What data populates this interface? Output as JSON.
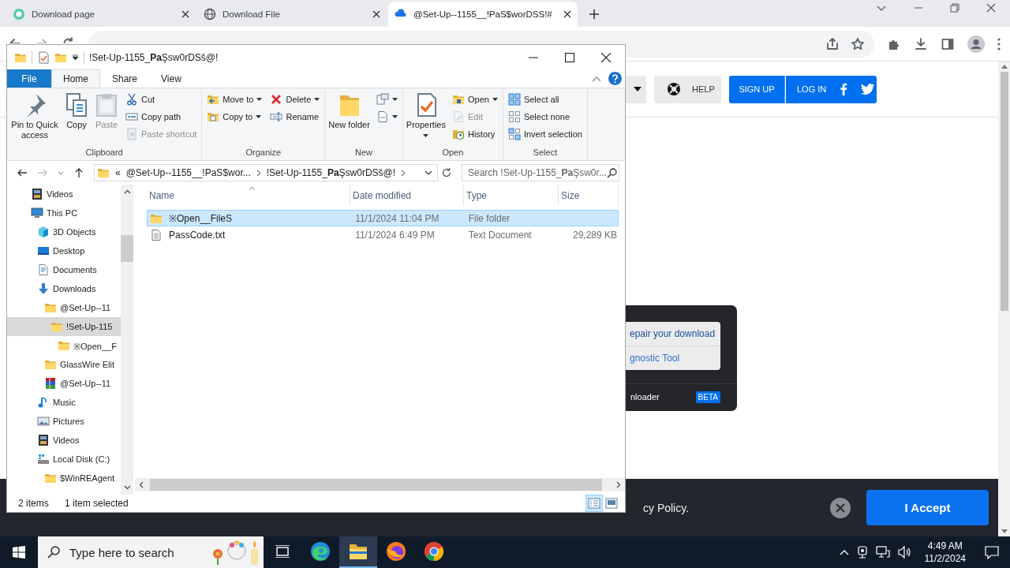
{
  "browser": {
    "tabs": [
      {
        "title": "Download page",
        "kind": "circle",
        "selected": false
      },
      {
        "title": "Download File",
        "kind": "globe",
        "selected": false
      },
      {
        "title": "@Set-Up--1155__!PaS$worDSS!#",
        "kind": "cloud",
        "selected": true
      }
    ]
  },
  "site": {
    "header_buttons": [
      {
        "kind": "menu"
      },
      {
        "kind": "help",
        "label": "HELP"
      },
      {
        "kind": "signup",
        "label": "SIGN UP"
      },
      {
        "kind": "login",
        "label": "LOG IN"
      }
    ],
    "popup": {
      "links": [
        "epair your download",
        "gnostic Tool"
      ],
      "footer": "nloader",
      "badge": "BETA"
    },
    "cookie_bar": {
      "text": "cy Policy.",
      "button": "I Accept"
    }
  },
  "explorer": {
    "title": "!Set-Up-1155_**Pa**Şsw0rDSš@!",
    "ribbon_tabs": [
      {
        "label": "File",
        "kind": "file",
        "selected": false
      },
      {
        "label": "Home",
        "kind": "tab",
        "selected": true
      },
      {
        "label": "Share",
        "kind": "tab",
        "selected": false
      },
      {
        "label": "View",
        "kind": "tab",
        "selected": false
      }
    ],
    "ribbon_groups": [
      {
        "label": "Clipboard",
        "large": [
          {
            "label": "Pin to Quick access",
            "kind": "pin",
            "disabled": false
          },
          {
            "label": "Copy",
            "kind": "copy",
            "disabled": false
          },
          {
            "label": "Paste",
            "kind": "paste",
            "disabled": true
          }
        ],
        "stacks": [
          [
            {
              "label": "Cut",
              "kind": "cut",
              "disabled": false
            },
            {
              "label": "Copy path",
              "kind": "copypath",
              "disabled": false
            },
            {
              "label": "Paste shortcut",
              "kind": "pasteshortcut",
              "disabled": true
            }
          ]
        ]
      },
      {
        "label": "Organize",
        "stacks": [
          [
            {
              "label": "Move to",
              "kind": "moveto",
              "menu": true,
              "disabled": false
            },
            {
              "label": "Copy to",
              "kind": "copyto",
              "menu": true,
              "disabled": false
            }
          ],
          [
            {
              "label": "Delete",
              "kind": "delete",
              "menu": true,
              "disabled": false
            },
            {
              "label": "Rename",
              "kind": "rename",
              "disabled": false
            }
          ]
        ]
      },
      {
        "label": "New",
        "large": [
          {
            "label": "New folder",
            "kind": "newfolder",
            "disabled": false
          }
        ],
        "stacks": [
          [
            {
              "kind": "newitem",
              "menu": true,
              "disabled": false
            },
            {
              "kind": "easyaccess",
              "menu": true,
              "disabled": false
            }
          ]
        ]
      },
      {
        "label": "Open",
        "large": [
          {
            "label": "Properties",
            "kind": "properties",
            "menu": true,
            "disabled": false
          }
        ],
        "stacks": [
          [
            {
              "label": "Open",
              "kind": "open",
              "menu": true,
              "disabled": false
            },
            {
              "label": "Edit",
              "kind": "edit",
              "disabled": true
            },
            {
              "label": "History",
              "kind": "history",
              "disabled": false
            }
          ]
        ]
      },
      {
        "label": "Select",
        "stacks": [
          [
            {
              "label": "Select all",
              "kind": "selectall",
              "disabled": false
            },
            {
              "label": "Select none",
              "kind": "selectnone",
              "disabled": false
            },
            {
              "label": "Invert selection",
              "kind": "invert",
              "disabled": false
            }
          ]
        ]
      }
    ],
    "address": {
      "overflow": "«",
      "crumbs": [
        "@Set-Up--1155__!PaS$wor...",
        "!Set-Up-1155_**Pa**Şsw0rDSš@!"
      ]
    },
    "search_placeholder": "Search !Set-Up-1155_**Pa**Şsw0r...",
    "nav_tree": [
      {
        "label": "Videos",
        "kind": "videos",
        "selected": false
      },
      {
        "label": "This PC",
        "kind": "pc",
        "selected": false,
        "children": [
          {
            "label": "3D Objects",
            "kind": "cube",
            "selected": false
          },
          {
            "label": "Desktop",
            "kind": "desktop",
            "selected": false
          },
          {
            "label": "Documents",
            "kind": "documents",
            "selected": false
          },
          {
            "label": "Downloads",
            "kind": "downloads",
            "selected": false,
            "children": [
              {
                "label": "@Set-Up--11",
                "kind": "folder",
                "selected": false,
                "children": [
                  {
                    "label": "!Set-Up-115",
                    "kind": "folder",
                    "selected": true,
                    "children": [
                      {
                        "label": "※Open__F",
                        "kind": "folder",
                        "selected": false
                      }
                    ]
                  }
                ]
              },
              {
                "label": "GlassWire Elit",
                "kind": "folder",
                "selected": false
              },
              {
                "label": "@Set-Up--11",
                "kind": "archive",
                "selected": false
              }
            ]
          },
          {
            "label": "Music",
            "kind": "music",
            "selected": false
          },
          {
            "label": "Pictures",
            "kind": "pictures",
            "selected": false
          },
          {
            "label": "Videos",
            "kind": "videos",
            "selected": false
          },
          {
            "label": "Local Disk (C:)",
            "kind": "disk",
            "selected": false,
            "children": [
              {
                "label": "$WinREAgent",
                "kind": "folder",
                "selected": false
              }
            ]
          }
        ]
      }
    ],
    "columns": [
      {
        "label": "Name",
        "sorted": true
      },
      {
        "label": "Date modified",
        "sorted": false
      },
      {
        "label": "Type",
        "sorted": false
      },
      {
        "label": "Size",
        "sorted": false
      }
    ],
    "rows": [
      {
        "name": "※Open__FileS",
        "date": "11/1/2024 11:04 PM",
        "type": "File folder",
        "kind": "folder",
        "selected": true
      },
      {
        "name": "PassCode.txt",
        "date": "11/1/2024 6:49 PM",
        "type": "Text Document",
        "size": "29,289 KB",
        "kind": "textdoc",
        "selected": false
      }
    ],
    "status": {
      "count": "2 items",
      "selection": "1 item selected"
    },
    "views": [
      {
        "kind": "details",
        "selected": true
      },
      {
        "kind": "largeicons",
        "selected": false
      }
    ]
  },
  "taskbar": {
    "search_placeholder": "Type here to search",
    "apps": [
      {
        "kind": "taskview",
        "selected": false
      },
      {
        "kind": "edge",
        "selected": false
      },
      {
        "kind": "explorer",
        "selected": true
      },
      {
        "kind": "firefox",
        "selected": false
      },
      {
        "kind": "chrome",
        "selected": false
      }
    ],
    "time": "4:49 AM",
    "date": "11/2/2024"
  }
}
